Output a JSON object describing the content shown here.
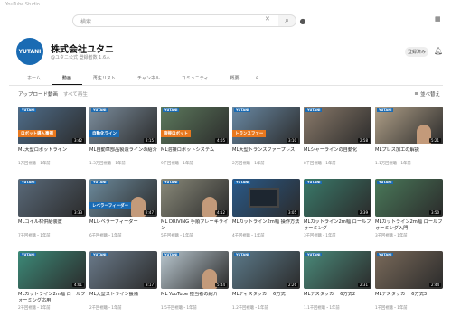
{
  "window": {
    "title": "YouTube Studio"
  },
  "search": {
    "value": "検索",
    "placeholder": "検索"
  },
  "channel": {
    "avatar_text": "YUTANI",
    "name": "株式会社ユタニ",
    "meta": "@ユタニ公式 登録者数 1.6人",
    "subscribe_label": "登録済み"
  },
  "tabs": [
    {
      "label": "ホーム"
    },
    {
      "label": "動画"
    },
    {
      "label": "再生リスト"
    },
    {
      "label": "チャンネル"
    },
    {
      "label": "コミュニティ"
    },
    {
      "label": "概要"
    }
  ],
  "filter": {
    "label": "アップロード動画",
    "sub": "すべて再生"
  },
  "sort": {
    "label": "並べ替え"
  },
  "videos": [
    {
      "title": "ML大型ロボットライン",
      "meta": "1万回視聴・1年前",
      "duration": "3:42",
      "band": "ロボット導入事例",
      "band_color": "#e8781e",
      "bg": "#4f6d8a",
      "kind": "machine"
    },
    {
      "title": "ML自動車部品製造ラインの紹介",
      "meta": "1.3万回視聴・1年前",
      "duration": "2:15",
      "band": "自動化ライン",
      "band_color": "#1a6bb3",
      "bg": "#7c8e9e",
      "kind": "machine"
    },
    {
      "title": "ML溶接ロボットシステム",
      "meta": "9千回視聴・1年前",
      "duration": "4:05",
      "band": "溶接ロボット",
      "band_color": "#e8781e",
      "bg": "#5d7a5d",
      "kind": "machine"
    },
    {
      "title": "ML大型トランスファープレス",
      "meta": "2万回視聴・1年前",
      "duration": "3:10",
      "band": "トランスファー",
      "band_color": "#e8781e",
      "bg": "#6a8aa5",
      "kind": "machine"
    },
    {
      "title": "MLシャーラインの自動化",
      "meta": "8千回視聴・1年前",
      "duration": "2:58",
      "band": "",
      "band_color": "#1a6bb3",
      "bg": "#8a7a6a",
      "kind": "machine"
    },
    {
      "title": "MLプレス加工の解説",
      "meta": "1.1万回視聴・1年前",
      "duration": "5:21",
      "band": "",
      "band_color": "#1a6bb3",
      "bg": "#b0a088",
      "kind": "person"
    },
    {
      "title": "MLコイル材供給装置",
      "meta": "7千回視聴・1年前",
      "duration": "3:33",
      "band": "",
      "band_color": "#1a6bb3",
      "bg": "#5a6a7a",
      "kind": "machine"
    },
    {
      "title": "MLレベラーフィーダー",
      "meta": "6千回視聴・1年前",
      "duration": "2:47",
      "band": "レベラーフィーダー",
      "band_color": "#1a6bb3",
      "bg": "#6c8a9c",
      "kind": "person"
    },
    {
      "title": "ML DRIVING 手順ブレーキライン",
      "meta": "5千回視聴・1年前",
      "duration": "4:12",
      "band": "",
      "band_color": "#1a6bb3",
      "bg": "#8a8a7a",
      "kind": "person"
    },
    {
      "title": "MLカットライン2m幅 操作方法",
      "meta": "4千回視聴・1年前",
      "duration": "3:05",
      "band": "",
      "band_color": "#1a6bb3",
      "bg": "#2a5a8a",
      "kind": "screen"
    },
    {
      "title": "MLカットライン2m幅 ロールフォーミング",
      "meta": "3千回視聴・1年前",
      "duration": "2:39",
      "band": "",
      "band_color": "#1a6bb3",
      "bg": "#3a7a6a",
      "kind": "machine"
    },
    {
      "title": "MLカットライン2m幅 ロールフォーミング入門",
      "meta": "3千回視聴・1年前",
      "duration": "3:50",
      "band": "",
      "band_color": "#1a6bb3",
      "bg": "#4a7a5a",
      "kind": "machine"
    },
    {
      "title": "MLカットライン2m幅 ロールフォーミング応用",
      "meta": "2千回視聴・1年前",
      "duration": "4:01",
      "band": "",
      "band_color": "#1a6bb3",
      "bg": "#3c8a78",
      "kind": "machine"
    },
    {
      "title": "ML大型ストライン設備",
      "meta": "2千回視聴・1年前",
      "duration": "3:17",
      "band": "",
      "band_color": "#1a6bb3",
      "bg": "#6a7a8a",
      "kind": "machine"
    },
    {
      "title": "ML YouTube 担当者の紹介",
      "meta": "1.5千回視聴・1年前",
      "duration": "5:44",
      "band": "",
      "band_color": "#1a6bb3",
      "bg": "#b9c7cf",
      "kind": "person"
    },
    {
      "title": "MLディスタッカー 6方式",
      "meta": "1.2千回視聴・1年前",
      "duration": "2:26",
      "band": "",
      "band_color": "#1a6bb3",
      "bg": "#5c7a8a",
      "kind": "machine"
    },
    {
      "title": "MLデスタッカー 6方式2",
      "meta": "1.1千回視聴・1年前",
      "duration": "2:31",
      "band": "",
      "band_color": "#1a6bb3",
      "bg": "#4a8a7a",
      "kind": "machine"
    },
    {
      "title": "MLデスタッカー 6方式3",
      "meta": "1千回視聴・1年前",
      "duration": "2:44",
      "band": "",
      "band_color": "#1a6bb3",
      "bg": "#7a6a5a",
      "kind": "machine"
    }
  ],
  "colors": {
    "brand": "#1a6bb3",
    "accent": "#e8781e"
  },
  "icons": {
    "search": "search-icon",
    "mic": "mic-icon",
    "bell": "bell-icon",
    "sort": "sort-icon"
  }
}
